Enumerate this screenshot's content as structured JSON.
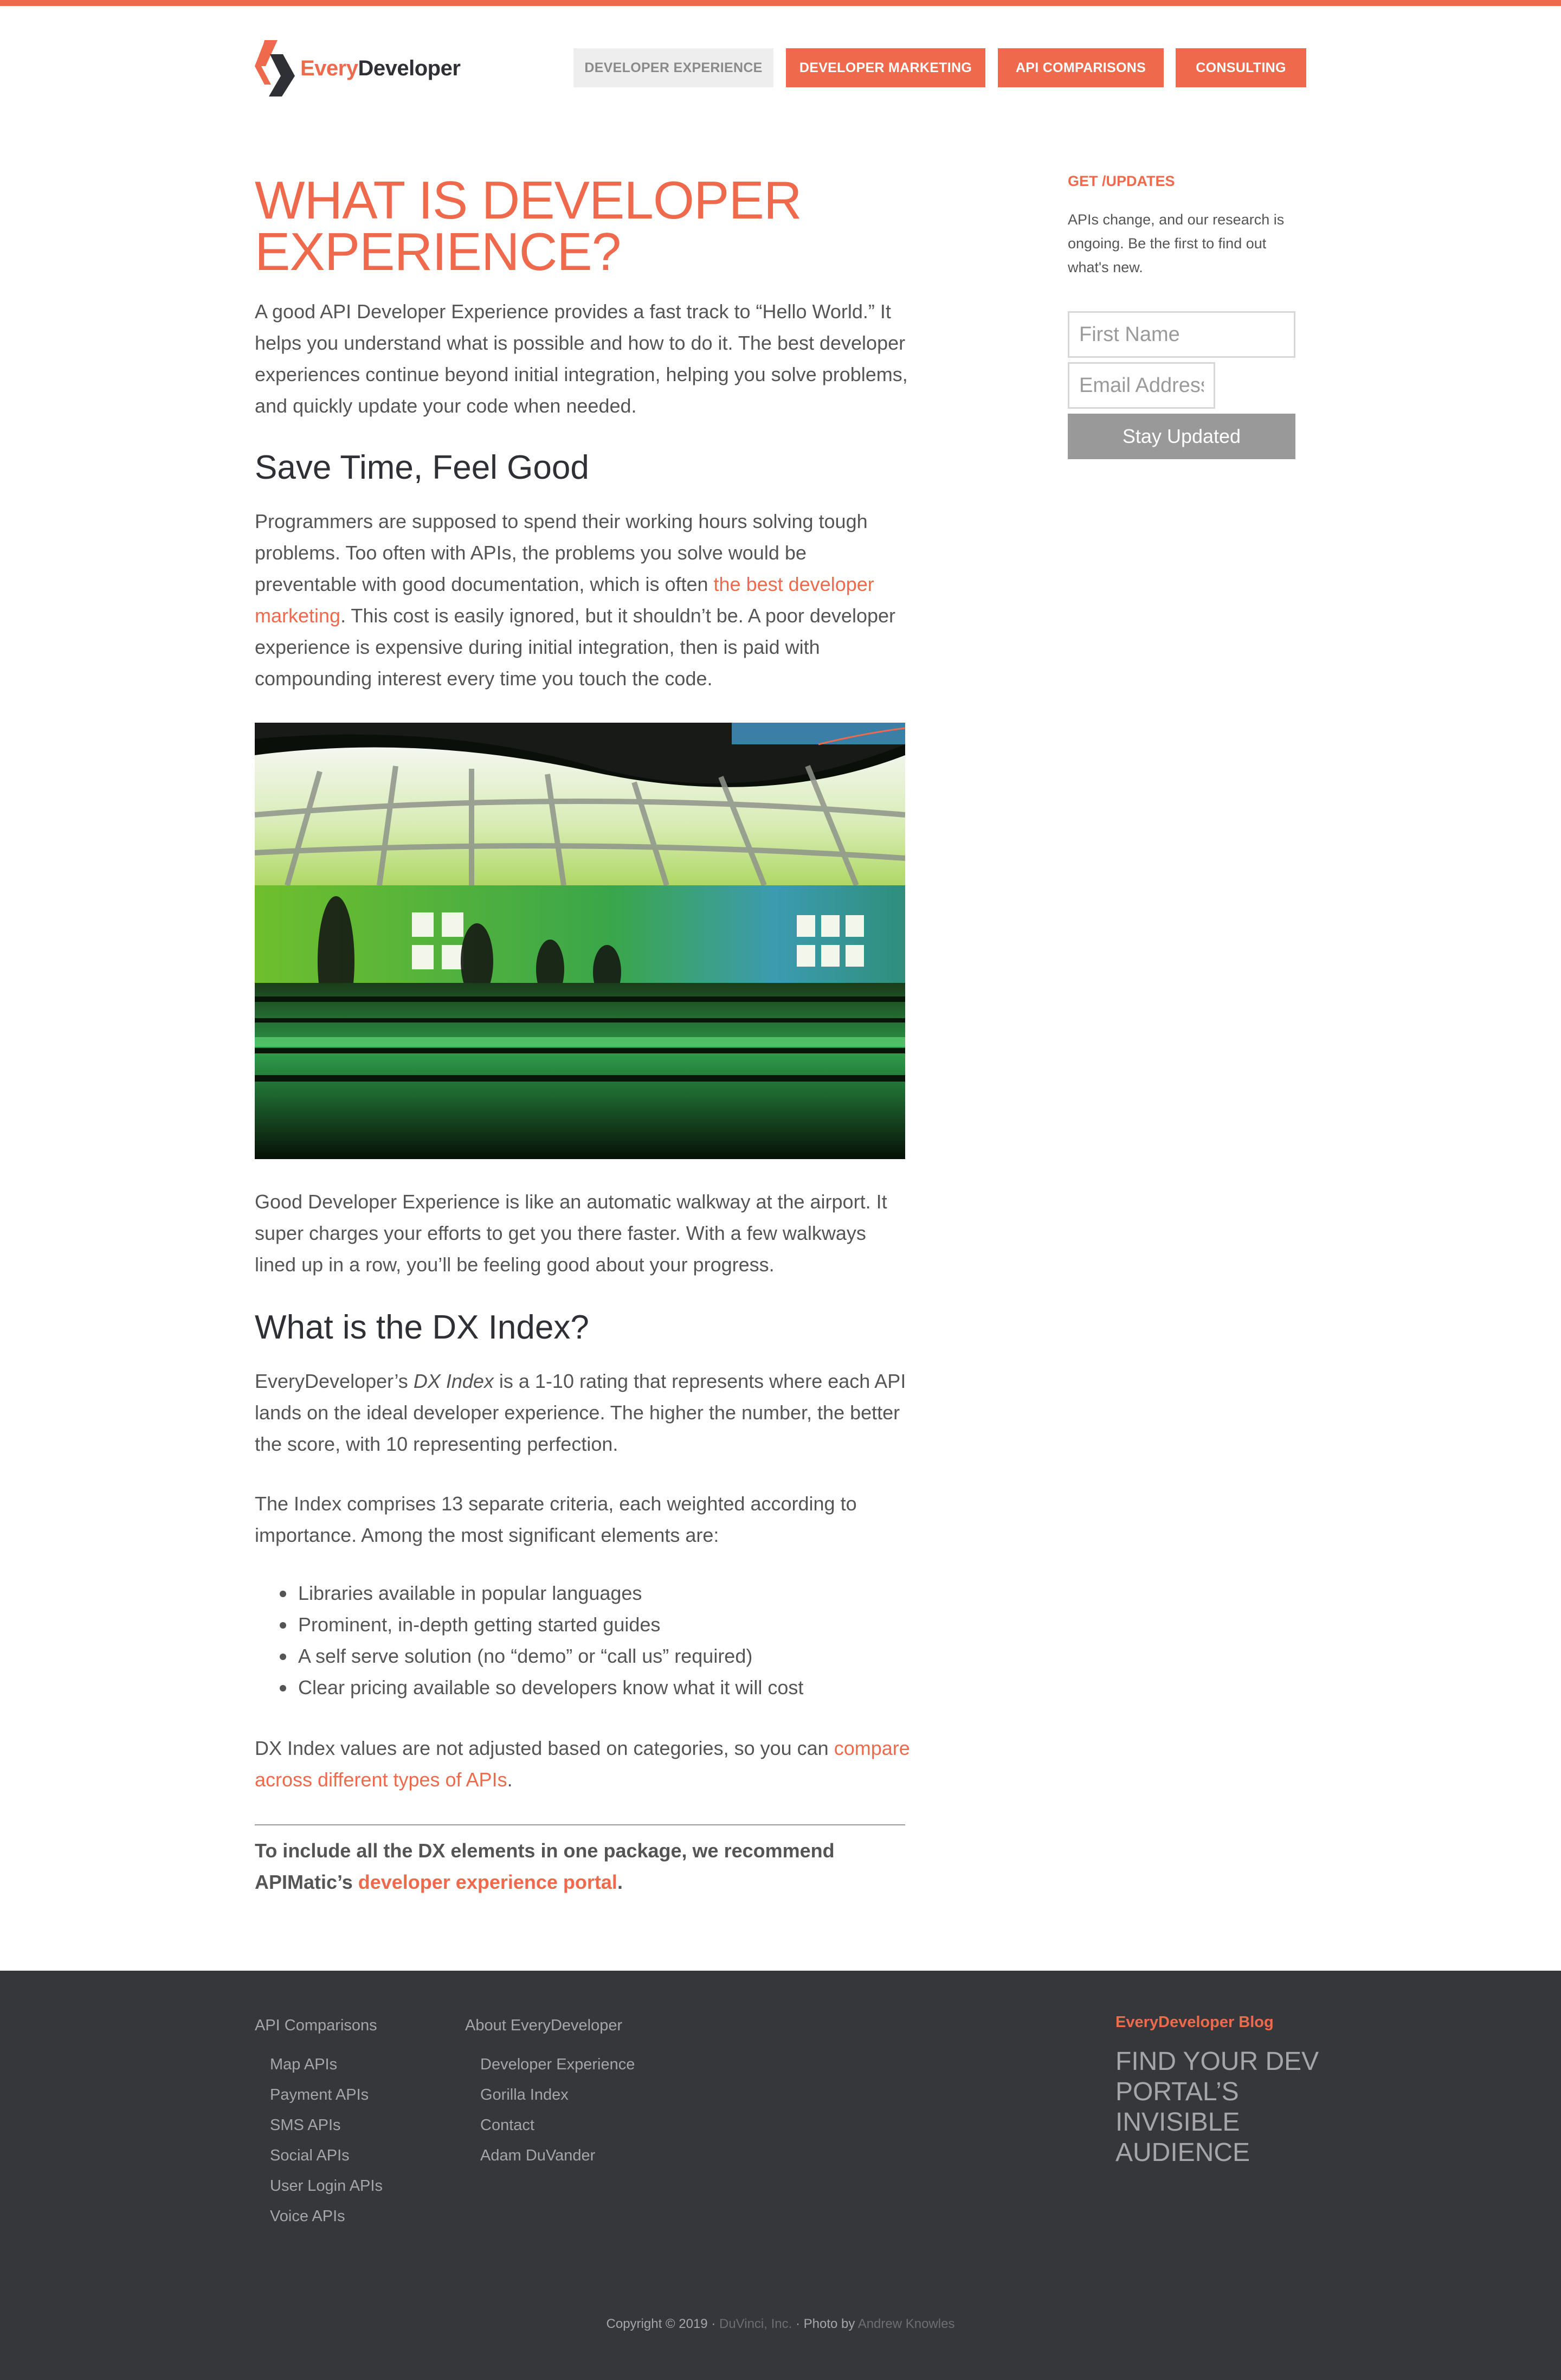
{
  "header": {
    "logo_every": "Every",
    "logo_developer": "Developer",
    "nav": [
      {
        "label": "Developer Experience",
        "active": true
      },
      {
        "label": "Developer Marketing",
        "active": false
      },
      {
        "label": "API Comparisons",
        "active": false
      },
      {
        "label": "Consulting",
        "active": false
      }
    ]
  },
  "article": {
    "title": "What is Developer Experience?",
    "intro": "A good API Developer Experience provides a fast track to “Hello World.” It helps you understand what is possible and how to do it. The best developer experiences continue beyond initial integration, helping you solve problems, and quickly update your code when needed.",
    "section1_heading": "Save Time, Feel Good",
    "section1_p_before": "Programmers are supposed to spend their working hours solving tough problems. Too often with APIs, the problems you solve would be preventable with good documentation, which is often ",
    "section1_link": "the best developer marketing",
    "section1_p_after": ". This cost is easily ignored, but it shouldn’t be. A poor developer experience is expensive during initial integration, then is paid with compounding interest every time you touch the code.",
    "image_caption": "Good Developer Experience is like an automatic walkway at the airport. It super charges your efforts to get you there faster. With a few walkways lined up in a row, you’ll be feeling good about your progress.",
    "section2_heading": "What is the DX Index?",
    "dx_p1_before": "EveryDeveloper’s ",
    "dx_p1_em": "DX Index",
    "dx_p1_after": " is a 1-10 rating that represents where each API lands on the ideal developer experience. The higher the number, the better the score, with 10 representing perfection.",
    "dx_p2": "The Index comprises 13 separate criteria, each weighted according to importance. Among the most significant elements are:",
    "bullets": [
      "Libraries available in popular languages",
      "Prominent, in-depth getting started guides",
      "A self serve solution (no “demo” or “call us” required)",
      "Clear pricing available so developers know what it will cost"
    ],
    "dx_p3_before": "DX Index values are not adjusted based on categories, so you can ",
    "dx_p3_link": "compare across different types of APIs",
    "dx_p3_after": ".",
    "recommend_before": "To include all the DX elements in one package, we recommend APIMatic’s ",
    "recommend_link": "developer experience portal",
    "recommend_after": "."
  },
  "sidebar": {
    "title": "Get /updates",
    "text": "APIs change, and our research is ongoing. Be the first to find out what's new.",
    "first_name_placeholder": "First Name",
    "email_placeholder": "Email Address",
    "button": "Stay Updated"
  },
  "footer": {
    "col1_title": "API Comparisons",
    "col1_items": [
      "Map APIs",
      "Payment APIs",
      "SMS APIs",
      "Social APIs",
      "User Login APIs",
      "Voice APIs"
    ],
    "col2_title": "About EveryDeveloper",
    "col2_items": [
      "Developer Experience",
      "Gorilla Index",
      "Contact",
      "Adam DuVander"
    ],
    "blog_title": "EveryDeveloper Blog",
    "blog_post": "Find your dev portal’s invisible audience",
    "copyright_before": "Copyright © 2019 · ",
    "copyright_company": "DuVinci, Inc.",
    "copyright_mid": " · Photo by ",
    "copyright_photographer": "Andrew Knowles"
  },
  "colors": {
    "accent": "#ef6a4c",
    "footer_bg": "#35373b",
    "text": "#555555"
  }
}
